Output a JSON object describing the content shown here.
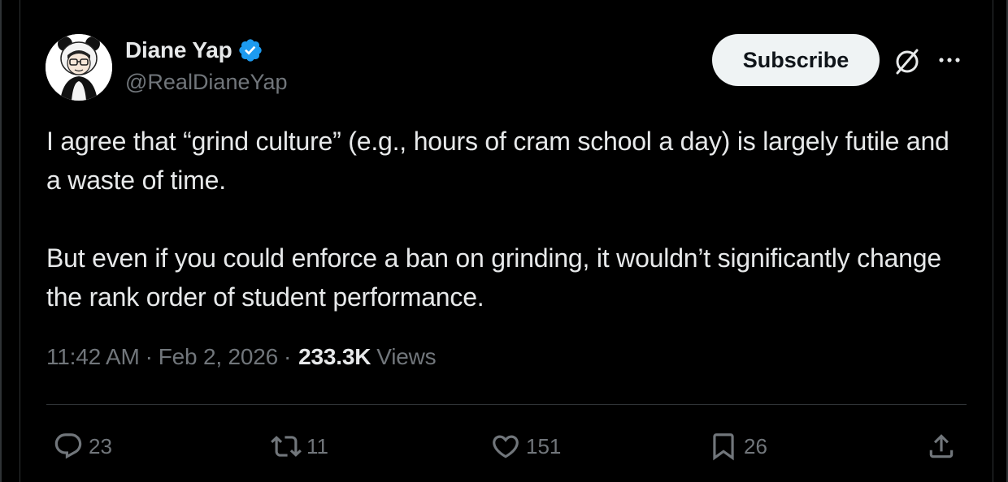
{
  "author": {
    "display_name": "Diane Yap",
    "handle": "@RealDianeYap",
    "verified": true,
    "verified_color": "#1d9bf0"
  },
  "header": {
    "subscribe_label": "Subscribe",
    "icons": [
      "grok-icon",
      "more-icon"
    ]
  },
  "tweet": {
    "paragraphs": [
      "I agree that “grind culture” (e.g., hours of cram school a day) is largely futile and a waste of time.",
      "But even if you could enforce a ban on grinding, it wouldn’t significantly change the rank order of student performance."
    ],
    "time": "11:42 AM",
    "date": "Feb 2, 2026",
    "separator": "·",
    "views_count": "233.3K",
    "views_label": "Views"
  },
  "actions": {
    "replies": "23",
    "reposts": "11",
    "likes": "151",
    "bookmarks": "26",
    "icons": [
      "reply-icon",
      "repost-icon",
      "like-icon",
      "bookmark-icon",
      "share-icon"
    ]
  },
  "colors": {
    "background": "#000000",
    "text_primary": "#e7e9ea",
    "text_secondary": "#71767b",
    "border": "#2f3336",
    "button_bg": "#eff3f4"
  }
}
